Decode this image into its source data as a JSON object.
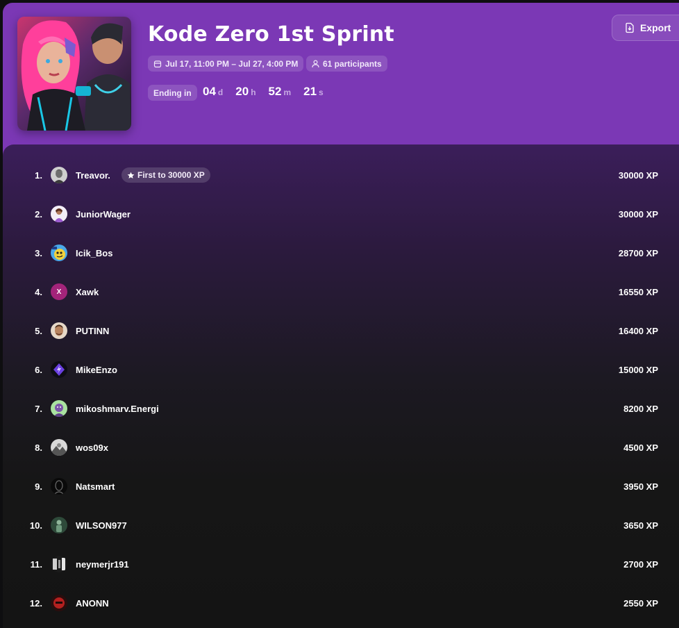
{
  "event": {
    "title": "Kode Zero 1st Sprint",
    "date_range": "Jul 17, 11:00 PM – Jul 27, 4:00 PM",
    "participants": "61 participants",
    "ending_label": "Ending in",
    "countdown": {
      "days": "04",
      "days_unit": "d",
      "hours": "20",
      "hours_unit": "h",
      "minutes": "52",
      "minutes_unit": "m",
      "seconds": "21",
      "seconds_unit": "s"
    },
    "export_label": "Export"
  },
  "colors": {
    "header_purple": "#7b38b5",
    "board_top": "#3b1e5a",
    "board_bottom": "#141414"
  },
  "leaderboard": [
    {
      "rank": "1.",
      "name": "Treavor.",
      "xp": "30000 XP",
      "badge": "First to 30000 XP",
      "avatar": "avatar-portrait-gray"
    },
    {
      "rank": "2.",
      "name": "JuniorWager",
      "xp": "30000 XP",
      "avatar": "avatar-purple-figure"
    },
    {
      "rank": "3.",
      "name": "Icik_Bos",
      "xp": "28700 XP",
      "avatar": "avatar-yellow-cartoon"
    },
    {
      "rank": "4.",
      "name": "Xawk",
      "xp": "16550 XP",
      "avatar": "avatar-letter-x",
      "avatar_letter": "X"
    },
    {
      "rank": "5.",
      "name": "PUTINN",
      "xp": "16400 XP",
      "avatar": "avatar-face"
    },
    {
      "rank": "6.",
      "name": "MikeEnzo",
      "xp": "15000 XP",
      "avatar": "avatar-purple-bolt"
    },
    {
      "rank": "7.",
      "name": "mikoshmarv.Energi",
      "xp": "8200 XP",
      "avatar": "avatar-green-character"
    },
    {
      "rank": "8.",
      "name": "wos09x",
      "xp": "4500 XP",
      "avatar": "avatar-gray-landscape"
    },
    {
      "rank": "9.",
      "name": "Natsmart",
      "xp": "3950 XP",
      "avatar": "avatar-dark-silhouette"
    },
    {
      "rank": "10.",
      "name": "WILSON977",
      "xp": "3650 XP",
      "avatar": "avatar-green-figure"
    },
    {
      "rank": "11.",
      "name": "neymerjr191",
      "xp": "2700 XP",
      "avatar": "avatar-bw-pattern"
    },
    {
      "rank": "12.",
      "name": "ANONN",
      "xp": "2550 XP",
      "avatar": "avatar-red-mask"
    }
  ]
}
